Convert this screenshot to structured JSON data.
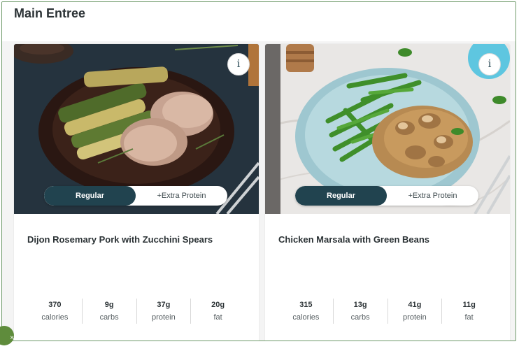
{
  "section": {
    "title": "Main Entree"
  },
  "meals": [
    {
      "name": "Dijon Rosemary Pork with Zucchini Spears",
      "image": "pork-zucchini-photo",
      "options": [
        "Regular",
        "+Extra Protein"
      ],
      "selected_option": "Regular",
      "info_icon": "i",
      "nutrition": [
        {
          "value": "370",
          "label": "calories"
        },
        {
          "value": "9g",
          "label": "carbs"
        },
        {
          "value": "37g",
          "label": "protein"
        },
        {
          "value": "20g",
          "label": "fat"
        }
      ]
    },
    {
      "name": "Chicken Marsala with Green Beans",
      "image": "chicken-greenbeans-photo",
      "options": [
        "Regular",
        "+Extra Protein"
      ],
      "selected_option": "Regular",
      "info_icon": "i",
      "nutrition": [
        {
          "value": "315",
          "label": "calories"
        },
        {
          "value": "13g",
          "label": "carbs"
        },
        {
          "value": "41g",
          "label": "protein"
        },
        {
          "value": "11g",
          "label": "fat"
        }
      ]
    }
  ],
  "colors": {
    "toggle_active": "#21434f",
    "frame_border": "#6f9a6a",
    "badge": "#5f8c3c"
  },
  "corner_badge_icon": "close-icon"
}
